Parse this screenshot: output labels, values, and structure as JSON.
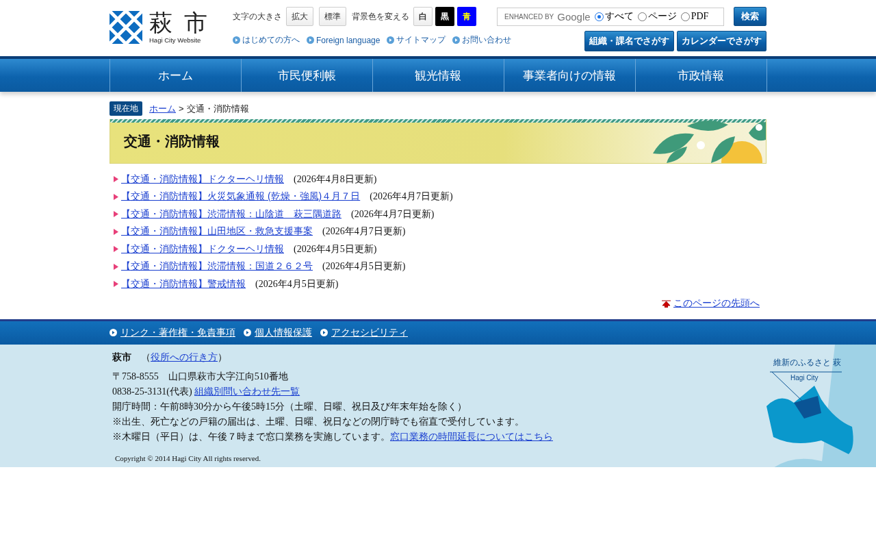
{
  "logo": {
    "name": "萩 市",
    "subtitle": "Hagi City Website"
  },
  "font_size": {
    "label": "文字の大きさ",
    "buttons": [
      "拡大",
      "標準"
    ]
  },
  "background_color": {
    "label": "背景色を変える",
    "options": [
      {
        "label": "白",
        "kind": "white"
      },
      {
        "label": "黒",
        "kind": "black"
      },
      {
        "label": "青",
        "kind": "blue"
      }
    ]
  },
  "utility_links": [
    "はじめての方へ",
    "Foreign language",
    "サイトマップ",
    "お問い合わせ"
  ],
  "search": {
    "branding_prefix": "ENHANCED BY",
    "branding": "Google",
    "scopes": [
      {
        "label": "すべて",
        "selected": true
      },
      {
        "label": "ページ",
        "selected": false
      },
      {
        "label": "PDF",
        "selected": false
      }
    ],
    "button": "検索"
  },
  "search_buttons": [
    "組織・課名でさがす",
    "カレンダーでさがす"
  ],
  "nav": [
    "ホーム",
    "市民便利帳",
    "観光情報",
    "事業者向けの情報",
    "市政情報"
  ],
  "breadcrumb": {
    "badge": "現在地",
    "links": [
      "ホーム"
    ],
    "separator": ">",
    "current": "交通・消防情報"
  },
  "page_title": "交通・消防情報",
  "articles": [
    {
      "title": "【交通・消防情報】ドクターヘリ情報",
      "updated": "(2026年4月8日更新)"
    },
    {
      "title": "【交通・消防情報】火災気象通報 (乾燥・強風)４月７日",
      "updated": "(2026年4月7日更新)"
    },
    {
      "title": "【交通・消防情報】渋滞情報：山陰道　萩三隅道路",
      "updated": "(2026年4月7日更新)"
    },
    {
      "title": "【交通・消防情報】山田地区・救急支援事案",
      "updated": "(2026年4月7日更新)"
    },
    {
      "title": "【交通・消防情報】ドクターヘリ情報",
      "updated": "(2026年4月5日更新)"
    },
    {
      "title": "【交通・消防情報】渋滞情報：国道２６２号",
      "updated": "(2026年4月5日更新)"
    },
    {
      "title": "【交通・消防情報】警戒情報",
      "updated": "(2026年4月5日更新)"
    }
  ],
  "page_top": "このページの先頭へ",
  "footer_links": [
    "リンク・著作権・免責事項",
    "個人情報保護",
    "アクセシビリティ"
  ],
  "footer": {
    "name": "萩市",
    "open_paren": "（",
    "access_link": "役所への行き方",
    "close_paren": "）",
    "address": "〒758-8555　山口県萩市大字江向510番地",
    "phone": "0838-25-3131(代表)",
    "phone_link": "組織別問い合わせ先一覧",
    "hours": "開庁時間：午前8時30分から午後5時15分（土曜、日曜、祝日及び年末年始を除く）",
    "notes": [
      {
        "text": "※出生、死亡などの戸籍の届出は、土曜、日曜、祝日などの閉庁時でも宿直で受付しています。"
      },
      {
        "text": "※木曜日（平日）は、午後７時まで窓口業務を実施しています。",
        "link": "窓口業務の時間延長についてはこちら"
      }
    ],
    "copyright": "Copyright © 2014 Hagi City All rights reserved.",
    "map": {
      "tagline": "維新のふるさと 萩",
      "label": "Hagi City"
    }
  }
}
